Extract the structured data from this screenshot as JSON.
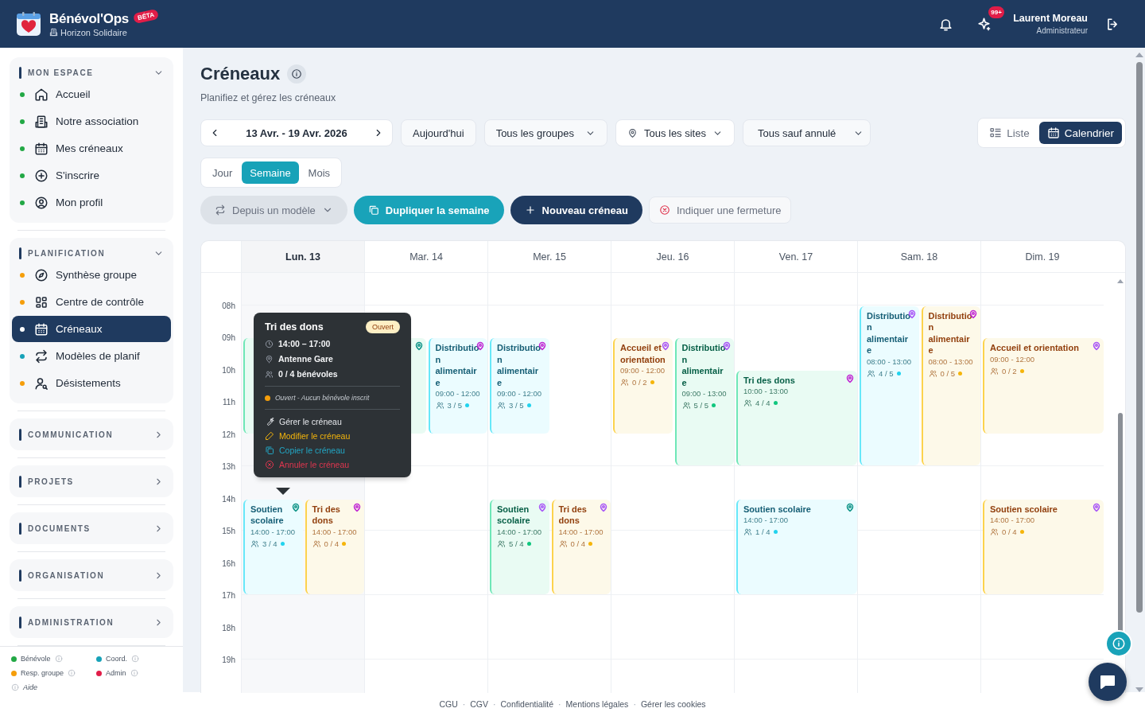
{
  "header": {
    "app_name": "Bénévol'Ops",
    "badge": "BÉTA",
    "organization": "Horizon Solidaire",
    "notifications_badge": "99+",
    "user_name": "Laurent Moreau",
    "user_role": "Administrateur"
  },
  "sidebar": {
    "sections": [
      {
        "title": "MON ESPACE",
        "expanded": true,
        "items": [
          {
            "label": "Accueil",
            "color": "#22a845",
            "selected": false
          },
          {
            "label": "Notre association",
            "color": "#22a845",
            "selected": false
          },
          {
            "label": "Mes créneaux",
            "color": "#22a845",
            "selected": false
          },
          {
            "label": "S'inscrire",
            "color": "#22a845",
            "selected": false
          },
          {
            "label": "Mon profil",
            "color": "#22a845",
            "selected": false
          }
        ]
      },
      {
        "title": "PLANIFICATION",
        "expanded": true,
        "items": [
          {
            "label": "Synthèse groupe",
            "color": "#f59e0b",
            "selected": false
          },
          {
            "label": "Centre de contrôle",
            "color": "#f59e0b",
            "selected": false
          },
          {
            "label": "Créneaux",
            "color": "#ffffff",
            "selected": true
          },
          {
            "label": "Modèles de planif",
            "color": "#17a2b8",
            "selected": false
          },
          {
            "label": "Désistements",
            "color": "#f59e0b",
            "selected": false
          }
        ]
      },
      {
        "title": "COMMUNICATION",
        "expanded": false
      },
      {
        "title": "PROJETS",
        "expanded": false
      },
      {
        "title": "DOCUMENTS",
        "expanded": false
      },
      {
        "title": "ORGANISATION",
        "expanded": false
      },
      {
        "title": "ADMINISTRATION",
        "expanded": false
      }
    ],
    "legend": [
      {
        "label": "Bénévole",
        "color": "#22a845"
      },
      {
        "label": "Resp. groupe",
        "color": "#f59e0b"
      },
      {
        "label": "Coord.",
        "color": "#17a2b8"
      },
      {
        "label": "Admin",
        "color": "#e11d48"
      }
    ],
    "help": "Aide"
  },
  "page": {
    "title": "Créneaux",
    "subtitle": "Planifiez et gérez les créneaux"
  },
  "filters": {
    "date_range": "13 Avr. - 19 Avr. 2026",
    "today": "Aujourd'hui",
    "groups": "Tous les groupes",
    "sites": "Tous les sites",
    "status": "Tous sauf annulé"
  },
  "view_toggle": [
    {
      "label": "Liste",
      "selected": false
    },
    {
      "label": "Calendrier",
      "selected": true
    }
  ],
  "period_tabs": [
    {
      "label": "Jour",
      "selected": false
    },
    {
      "label": "Semaine",
      "selected": true
    },
    {
      "label": "Mois",
      "selected": false
    }
  ],
  "actions": [
    {
      "label": "Depuis un modèle",
      "kind": "template"
    },
    {
      "label": "Dupliquer la semaine",
      "kind": "duplicate"
    },
    {
      "label": "Nouveau créneau",
      "kind": "new"
    },
    {
      "label": "Indiquer une fermeture",
      "kind": "closure"
    }
  ],
  "calendar": {
    "hours": [
      "08h",
      "09h",
      "10h",
      "11h",
      "12h",
      "13h",
      "14h",
      "15h",
      "16h",
      "17h",
      "18h",
      "19h"
    ],
    "days": [
      {
        "label": "Lun. 13",
        "today": true,
        "lanes": [
          [
            {
              "kind": "complete"
            },
            {
              "title": "Soutien scolaire",
              "time": "14:00 - 17:00",
              "count": "3 / 4",
              "kind": "partial",
              "color": "#0f9488"
            }
          ],
          [
            {
              "title": "Tri des dons",
              "time": "14:00 - 17:00",
              "count": "0 / 4",
              "kind": "empty",
              "color": "#c026d3"
            }
          ]
        ]
      },
      {
        "label": "Mar. 14",
        "today": false,
        "lanes": [
          [
            {
              "kind": "complete",
              "color": "#0f9488"
            }
          ],
          [
            {
              "title": "Distribution alimentaire",
              "time": "09:00 - 12:00",
              "count": "3 / 5",
              "kind": "partial",
              "color": "#c026d3"
            }
          ]
        ]
      },
      {
        "label": "Mer. 15",
        "today": false,
        "lanes": [
          [
            {
              "title": "Distribution alimentaire",
              "time": "09:00 - 12:00",
              "count": "3 / 5",
              "kind": "partial",
              "color": "#c026d3"
            },
            {
              "title": "Soutien scolaire",
              "time": "14:00 - 17:00",
              "count": "5 / 4",
              "kind": "complete",
              "color": "#a855f7"
            }
          ],
          [
            {
              "title": "Tri des dons",
              "time": "14:00 - 17:00",
              "count": "0 / 4",
              "kind": "empty",
              "color": "#a855f7"
            }
          ]
        ]
      },
      {
        "label": "Jeu. 16",
        "today": false,
        "lanes": [
          [
            {
              "title": "Accueil et orientation",
              "time": "09:00 - 12:00",
              "count": "0 / 2",
              "kind": "empty",
              "color": "#a855f7"
            }
          ],
          [
            {
              "title": "Distribution alimentaire",
              "time": "09:00 - 13:00",
              "count": "5 / 5",
              "kind": "complete",
              "color": "#a855f7"
            }
          ]
        ]
      },
      {
        "label": "Ven. 17",
        "today": false,
        "lanes": [
          [
            {
              "title": "Tri des dons",
              "time": "10:00 - 13:00",
              "count": "4 / 4",
              "kind": "complete",
              "color": "#c026d3"
            },
            {
              "title": "Soutien scolaire",
              "time": "14:00 - 17:00",
              "count": "1 / 4",
              "kind": "partial",
              "color": "#0f9488"
            }
          ]
        ]
      },
      {
        "label": "Sam. 18",
        "today": false,
        "lanes": [
          [
            {
              "title": "Distribution alimentaire",
              "time": "08:00 - 13:00",
              "count": "4 / 5",
              "kind": "partial",
              "color": "#a855f7"
            }
          ],
          [
            {
              "title": "Distribution alimentaire",
              "time": "08:00 - 13:00",
              "count": "0 / 5",
              "kind": "empty",
              "color": "#c026d3"
            }
          ]
        ]
      },
      {
        "label": "Dim. 19",
        "today": false,
        "lanes": [
          [
            {
              "title": "Accueil et orientation",
              "time": "09:00 - 12:00",
              "count": "0 / 2",
              "kind": "empty",
              "color": "#a855f7"
            },
            {
              "title": "Soutien scolaire",
              "time": "14:00 - 17:00",
              "count": "0 / 4",
              "kind": "empty",
              "color": "#a855f7"
            }
          ]
        ]
      }
    ]
  },
  "tooltip": {
    "title": "Tri des dons",
    "badge": "Ouvert",
    "time": "14:00 – 17:00",
    "site": "Antenne Gare",
    "volunteers": "0 / 4 bénévoles",
    "status": "Ouvert - Aucun bénévole inscrit",
    "color": "#f59e0b",
    "actions": [
      {
        "label": "Gérer le créneau",
        "kind": "manage"
      },
      {
        "label": "Modifier le créneau",
        "kind": "edit"
      },
      {
        "label": "Copier le créneau",
        "kind": "copy"
      },
      {
        "label": "Annuler le créneau",
        "kind": "cancel"
      }
    ]
  },
  "footer": {
    "separator": "·",
    "links": [
      "CGU",
      "CGV",
      "Confidentialité",
      "Mentions légales",
      "Gérer les cookies"
    ]
  }
}
